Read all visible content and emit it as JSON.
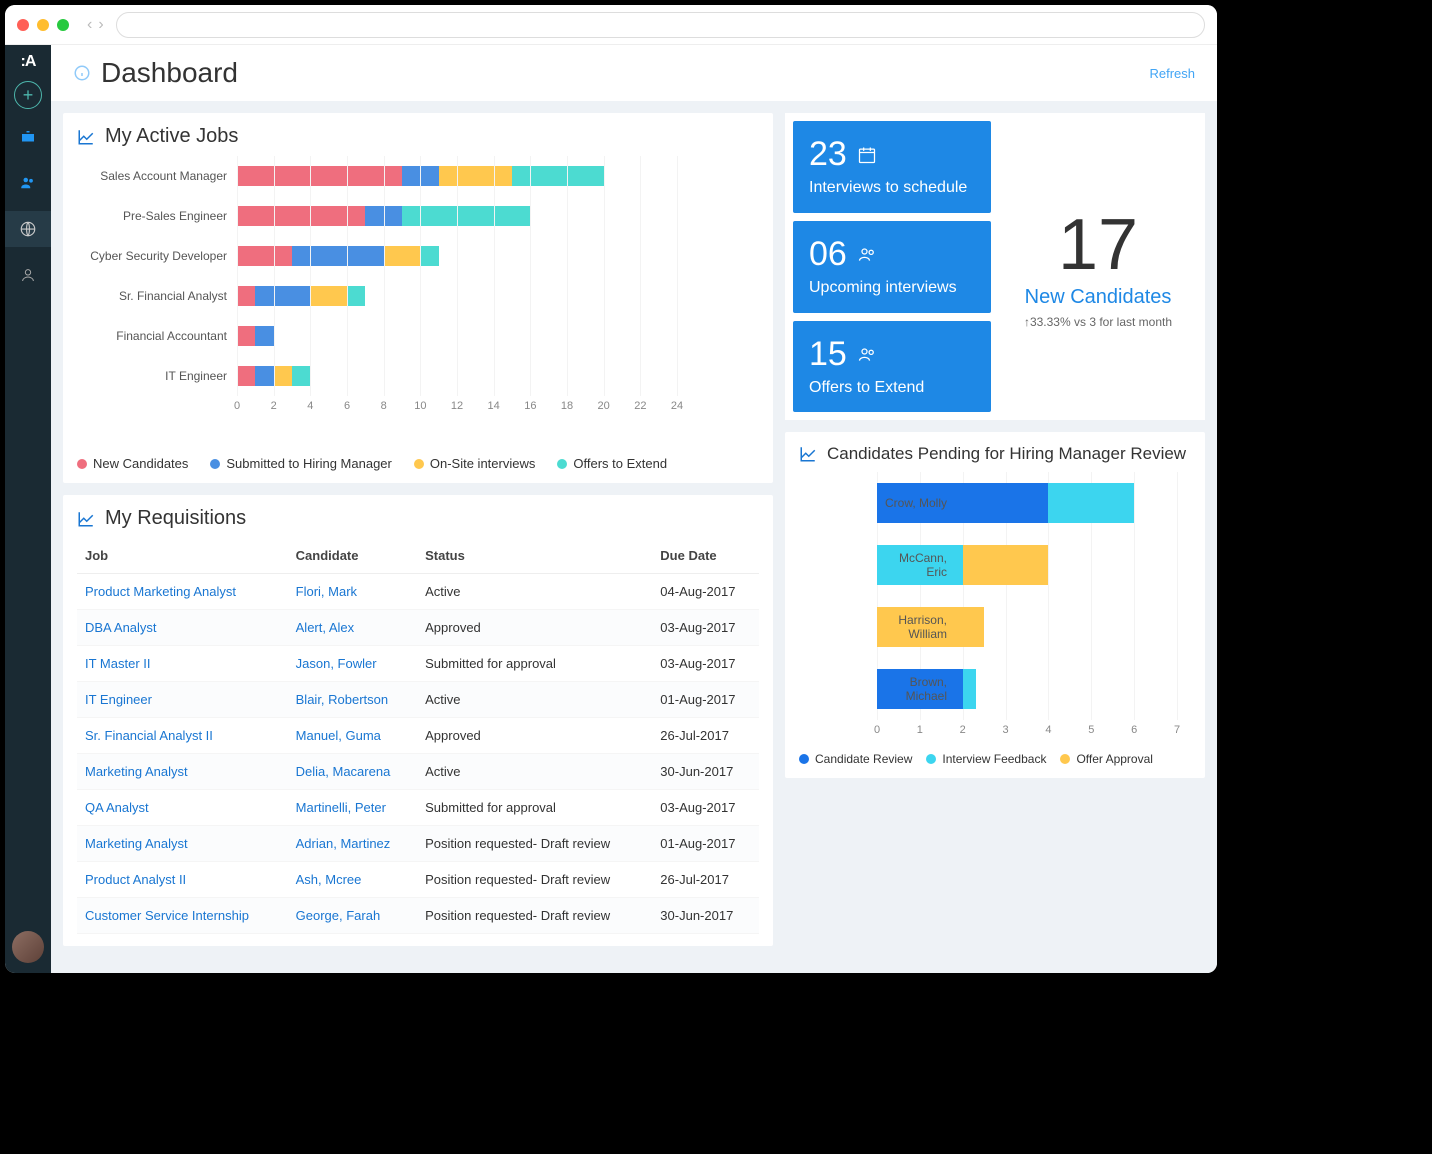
{
  "colors": {
    "newCandidates": "#ef6e7e",
    "submitted": "#498fe2",
    "onsite": "#ffc84e",
    "offers": "#4cdbd1",
    "candReview": "#1a74e8",
    "intFeedback": "#3cd5ef",
    "offerApproval": "#ffc84e"
  },
  "header": {
    "title": "Dashboard",
    "refresh": "Refresh"
  },
  "activeJobs": {
    "title": "My Active Jobs",
    "legend": [
      "New Candidates",
      "Submitted to Hiring Manager",
      "On-Site interviews",
      "Offers to Extend"
    ]
  },
  "kpis": {
    "interviewsToSchedule": {
      "num": "23",
      "label": "Interviews to schedule"
    },
    "upcomingInterviews": {
      "num": "06",
      "label": "Upcoming interviews"
    },
    "offersToExtend": {
      "num": "15",
      "label": "Offers to Extend"
    },
    "newCandidates": {
      "num": "17",
      "title": "New Candidates",
      "delta": "↑33.33% vs 3 for last month"
    }
  },
  "requisitions": {
    "title": "My Requisitions",
    "columns": [
      "Job",
      "Candidate",
      "Status",
      "Due Date"
    ],
    "rows": [
      {
        "job": "Product Marketing Analyst",
        "candidate": "Flori, Mark",
        "status": "Active",
        "due": "04-Aug-2017"
      },
      {
        "job": "DBA Analyst",
        "candidate": "Alert, Alex",
        "status": "Approved",
        "due": "03-Aug-2017"
      },
      {
        "job": "IT Master II",
        "candidate": "Jason, Fowler",
        "status": "Submitted for approval",
        "due": "03-Aug-2017"
      },
      {
        "job": "IT Engineer",
        "candidate": "Blair, Robertson",
        "status": "Active",
        "due": "01-Aug-2017"
      },
      {
        "job": "Sr. Financial Analyst II",
        "candidate": "Manuel, Guma",
        "status": "Approved",
        "due": "26-Jul-2017"
      },
      {
        "job": "Marketing Analyst",
        "candidate": "Delia, Macarena",
        "status": "Active",
        "due": "30-Jun-2017"
      },
      {
        "job": "QA Analyst",
        "candidate": "Martinelli, Peter",
        "status": "Submitted for approval",
        "due": "03-Aug-2017"
      },
      {
        "job": "Marketing Analyst",
        "candidate": "Adrian, Martinez",
        "status": "Position requested- Draft review",
        "due": "01-Aug-2017"
      },
      {
        "job": "Product Analyst II",
        "candidate": "Ash, Mcree",
        "status": "Position requested- Draft review",
        "due": "26-Jul-2017"
      },
      {
        "job": "Customer Service Internship",
        "candidate": "George, Farah",
        "status": "Position requested- Draft review",
        "due": "30-Jun-2017"
      }
    ]
  },
  "pending": {
    "title": "Candidates Pending for Hiring Manager Review",
    "legend": [
      "Candidate Review",
      "Interview Feedback",
      "Offer Approval"
    ]
  },
  "chart_data": [
    {
      "type": "bar",
      "title": "My Active Jobs",
      "orientation": "horizontal",
      "stacked": true,
      "categories": [
        "Sales Account Manager",
        "Pre-Sales Engineer",
        "Cyber Security Developer",
        "Sr. Financial Analyst",
        "Financial Accountant",
        "IT Engineer"
      ],
      "series": [
        {
          "name": "New Candidates",
          "values": [
            9,
            7,
            3,
            1,
            1,
            1
          ]
        },
        {
          "name": "Submitted to Hiring Manager",
          "values": [
            2,
            2,
            5,
            3,
            1,
            1
          ]
        },
        {
          "name": "On-Site interviews",
          "values": [
            4,
            0,
            2,
            2,
            0,
            1
          ]
        },
        {
          "name": "Offers to Extend",
          "values": [
            5,
            7,
            1,
            1,
            0,
            1
          ]
        }
      ],
      "xlim": [
        0,
        24
      ],
      "x_ticks": [
        0,
        2,
        4,
        6,
        8,
        10,
        12,
        14,
        16,
        18,
        20,
        22,
        24
      ],
      "xlabel": "",
      "ylabel": ""
    },
    {
      "type": "bar",
      "title": "Candidates Pending for Hiring Manager Review",
      "orientation": "horizontal",
      "stacked": true,
      "categories": [
        "Crow, Molly",
        "McCann, Eric",
        "Harrison, William",
        "Brown, Michael"
      ],
      "series": [
        {
          "name": "Candidate Review",
          "values": [
            4,
            0,
            0,
            2
          ]
        },
        {
          "name": "Interview Feedback",
          "values": [
            2,
            2,
            0,
            0.3
          ]
        },
        {
          "name": "Offer Approval",
          "values": [
            0,
            2,
            2.5,
            0
          ]
        }
      ],
      "xlim": [
        0,
        7
      ],
      "x_ticks": [
        0,
        1,
        2,
        3,
        4,
        5,
        6,
        7
      ],
      "xlabel": "",
      "ylabel": ""
    }
  ]
}
